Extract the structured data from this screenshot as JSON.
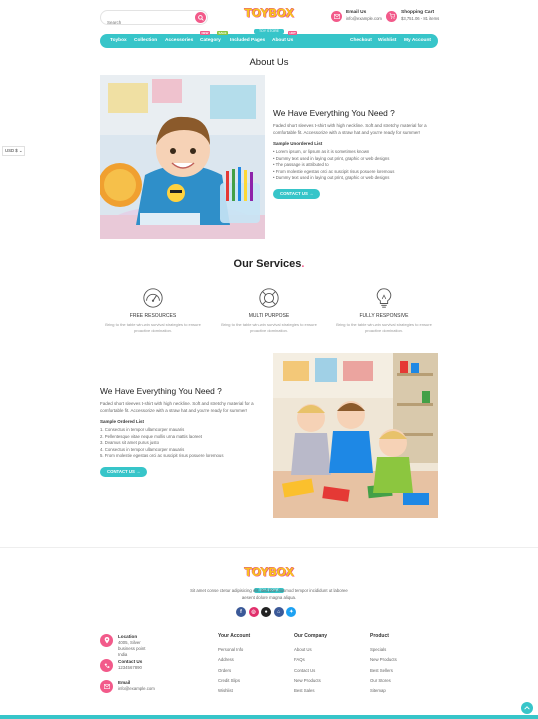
{
  "search": {
    "placeholder": "Search"
  },
  "logo": {
    "brand": "TOYBOX",
    "tagline": "TOY STORE"
  },
  "header": {
    "email_title": "Email Us",
    "email_value": "info@example.com",
    "cart_title": "Shopping Cart",
    "cart_value": "$3,751.06 - 81 items"
  },
  "nav": {
    "toybox": "Toybox",
    "collection": "Collection",
    "accessories": "Accessories",
    "accessories_badge": "NEW",
    "category": "Category",
    "category_badge": "SALE",
    "included_pages": "Included Pages",
    "about_us": "About Us",
    "about_us_badge": "HOT",
    "checkout": "Checkout",
    "wishlist": "Wishlist",
    "my_account": "My Account"
  },
  "currency": "USD $ ⌄",
  "about": {
    "title": "About Us",
    "heading": "We Have Everything You Need ?",
    "text": "Faded short sleeves t-shirt with high neckline. Soft and stretchy material for a comfortable fit. Accessorize with a straw hat and you're ready for summer!",
    "list_title": "Sample Unordered List",
    "list": [
      "Lorem ipsum, or lipsum as it is sometimes known",
      "Dummy text used in laying out print, graphic or web designs",
      "The passage is attributed to",
      "From molestie egestas orci ac suscipit risus posuere loremous",
      "Dummy text used in laying out print, graphic or web designs"
    ],
    "button": "CONTACT US →"
  },
  "services": {
    "title": "Our Services",
    "title_dot": ".",
    "items": [
      {
        "icon": "speedometer-icon",
        "title": "FREE RESOURCES",
        "desc": "Bring to the table win-win survival strategies to ensure proactive domination."
      },
      {
        "icon": "lifebuoy-icon",
        "title": "MULTI PURPOSE",
        "desc": "Bring to the table win-win survival strategies to ensure proactive domination."
      },
      {
        "icon": "lightbulb-icon",
        "title": "FULLY RESPONSIVE",
        "desc": "Bring to the table win-win survival strategies to ensure proactive domination."
      }
    ]
  },
  "second": {
    "heading": "We Have Everything You Need ?",
    "text": "Faded short sleeves t-shirt with high neckline. Soft and stretchy material for a comfortable fit. Accessorize with a straw hat and you're ready for summer!",
    "list_title": "Sample Ordered List",
    "list": [
      "1. Consectus in tempor ullamcorper mauaris",
      "2. Pellentesque vitae neque mollis urna mattis laoreet",
      "3. Dvamus sit amet purus justo",
      "4. Consectus in tempor ullamcorper mauaris",
      "5. From molestie egestas orci ac suscipit risus posuere loremous"
    ],
    "button": "CONTACT US →"
  },
  "footer": {
    "desc": "Sit amet conse ctetur adipisicing elit, sed doe eiusmod tempor incididunt ut laboree aesent dolore magna aliqua.",
    "social": [
      "f",
      "◎",
      "●",
      "⌂",
      "✦"
    ],
    "contact": [
      {
        "title": "Location",
        "value": "4005, Silver business point India"
      },
      {
        "title": "Contact Us",
        "value": "1234567890"
      },
      {
        "title": "Email",
        "value": "info@example.com"
      }
    ],
    "columns": [
      {
        "title": "Your Account",
        "links": [
          "Personal Info",
          "Address",
          "Orders",
          "Credit Slips",
          "Wishlist"
        ]
      },
      {
        "title": "Our Company",
        "links": [
          "About Us",
          "FAQs",
          "Contact Us",
          "New Products",
          "Best Sales"
        ]
      },
      {
        "title": "Product",
        "links": [
          "Specials",
          "New Products",
          "Best Sellers",
          "Our Stores",
          "Sitemap"
        ]
      }
    ]
  },
  "colors": {
    "primary": "#37c5c9",
    "accent": "#f25a8a",
    "logo_yellow": "#f9c21f"
  }
}
